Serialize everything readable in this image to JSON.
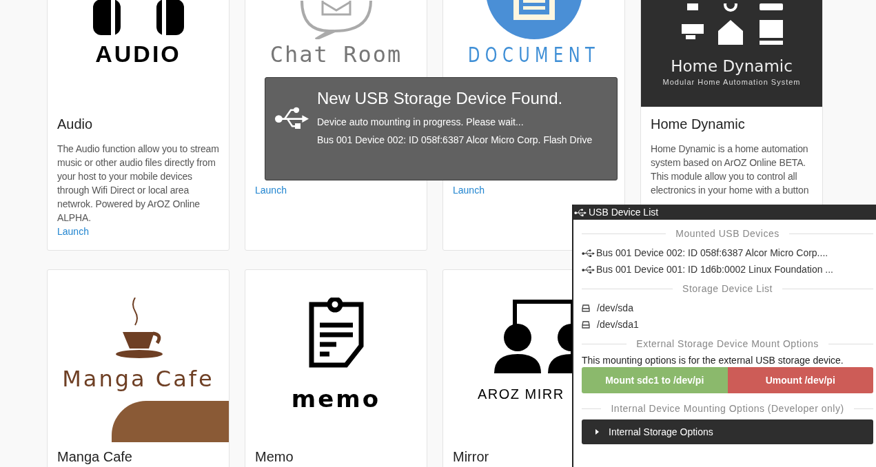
{
  "cards": [
    {
      "title": "Audio",
      "description": "The Audio function allow you to stream music or other audio files directly from your host to your mobile devices through Wifi Direct or local area netwrok. Powered by ArOZ Online ALPHA.",
      "link": "Launch",
      "logo": {
        "kind": "audio",
        "text": "AUDIO"
      }
    },
    {
      "link": "Launch",
      "logo": {
        "kind": "chat",
        "text": "Chat Room"
      }
    },
    {
      "link": "Launch",
      "logo": {
        "kind": "document",
        "text": "DOCUMENT"
      }
    },
    {
      "title": "Home Dynamic",
      "description": "Home Dynamic is a home automation system based on ArOZ Online BETA. This module allow you to control all electronics in your home with a button",
      "logo": {
        "kind": "home",
        "text": "Home Dynamic",
        "subtext": "Modular Home Automation System"
      }
    },
    {
      "title": "Manga Cafe",
      "logo": {
        "kind": "manga",
        "text": "Manga Cafe"
      }
    },
    {
      "title": "Memo",
      "logo": {
        "kind": "memo",
        "text": "memo"
      }
    },
    {
      "title": "Mirror",
      "logo": {
        "kind": "mirror",
        "text": "AROZ MIRR"
      }
    }
  ],
  "notification": {
    "title": "New USB Storage Device Found.",
    "message": "Device auto mounting in progress. Please wait...",
    "detail": "Bus 001 Device 002: ID 058f:6387 Alcor Micro Corp. Flash Drive"
  },
  "panel": {
    "title": "USB Device List",
    "sections": [
      {
        "kind": "usb",
        "heading": "Mounted USB Devices",
        "items": [
          "Bus 001 Device 002: ID 058f:6387 Alcor Micro Corp....",
          "Bus 001 Device 001: ID 1d6b:0002 Linux Foundation ..."
        ]
      },
      {
        "kind": "storage",
        "heading": "Storage Device List",
        "items": [
          "/dev/sda",
          "/dev/sda1"
        ]
      },
      {
        "kind": "mount",
        "heading": "External Storage Device Mount Options",
        "note": "This mounting options is for the external USB storage device.",
        "buttons": [
          {
            "label": "Mount sdc1 to /dev/pi",
            "kind": "positive"
          },
          {
            "label": "Umount /dev/pi",
            "kind": "negative"
          }
        ]
      },
      {
        "kind": "accordion",
        "heading": "Internal Device Mounting Options (Developer only)",
        "accordion": {
          "label": "Internal Storage Options",
          "expanded": false
        }
      }
    ]
  }
}
